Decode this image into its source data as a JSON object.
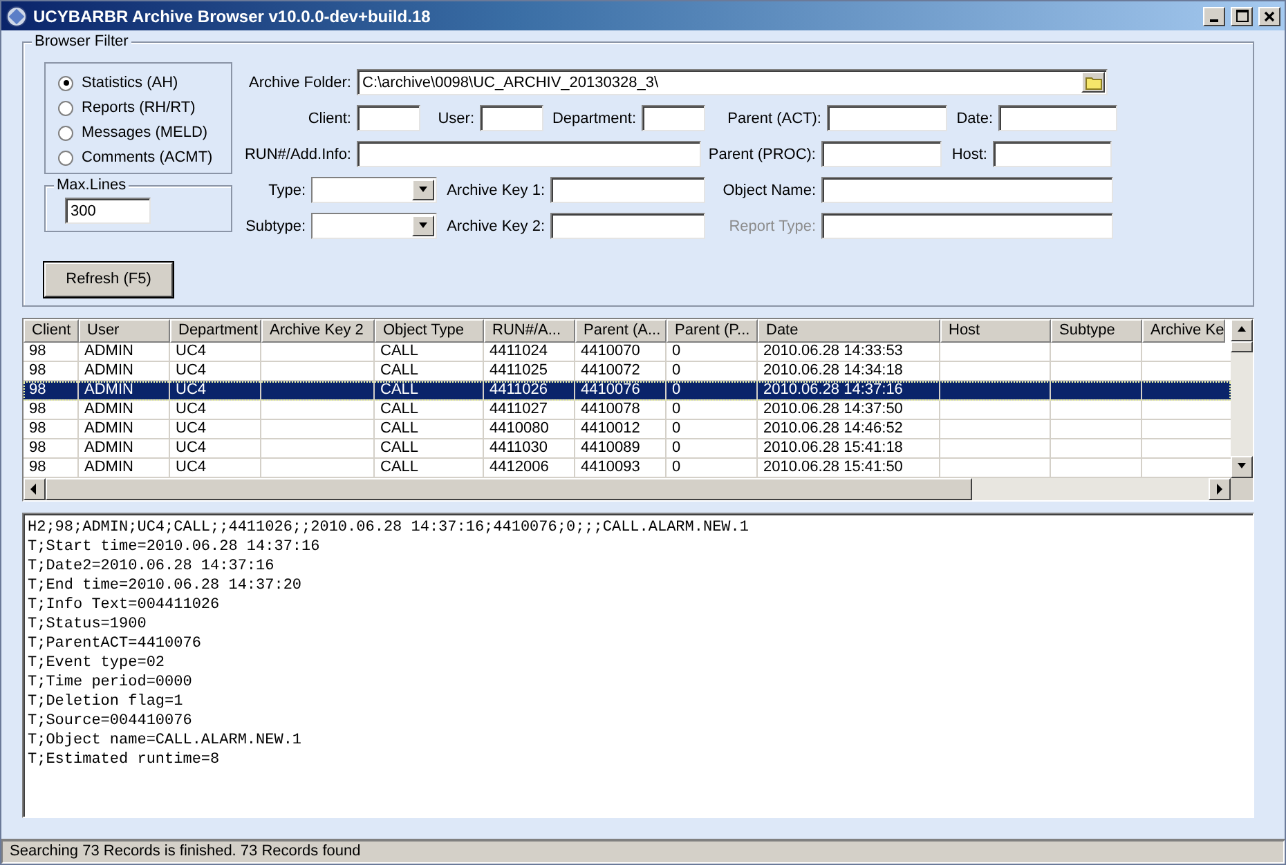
{
  "window": {
    "title": "UCYBARBR Archive Browser v10.0.0-dev+build.18"
  },
  "filter": {
    "title": "Browser Filter",
    "sources": [
      {
        "label": "Statistics (AH)",
        "selected": true
      },
      {
        "label": "Reports (RH/RT)",
        "selected": false
      },
      {
        "label": "Messages (MELD)",
        "selected": false
      },
      {
        "label": "Comments (ACMT)",
        "selected": false
      }
    ],
    "max_lines": {
      "title": "Max.Lines",
      "value": "300"
    },
    "fields": [
      {
        "label": "Archive Folder:",
        "kind": "folder",
        "value": "C:\\archive\\0098\\UC_ARCHIV_20130328_3\\"
      },
      {
        "label": "Client:",
        "kind": "field"
      },
      {
        "label": "User:",
        "kind": "field"
      },
      {
        "label": "Department:",
        "kind": "field"
      },
      {
        "label": "Parent (ACT):",
        "kind": "field"
      },
      {
        "label": "Date:",
        "kind": "field"
      },
      {
        "label": "RUN#/Add.Info:",
        "kind": "field"
      },
      {
        "label": "Parent (PROC):",
        "kind": "field"
      },
      {
        "label": "Host:",
        "kind": "field"
      },
      {
        "label": "Type:",
        "kind": "combo"
      },
      {
        "label": "Archive Key 1:",
        "kind": "field"
      },
      {
        "label": "Object Name:",
        "kind": "field"
      },
      {
        "label": "Subtype:",
        "kind": "combo"
      },
      {
        "label": "Archive Key 2:",
        "kind": "field"
      },
      {
        "label": "Report Type:",
        "kind": "field",
        "disabled": true
      }
    ],
    "refresh_button": "Refresh (F5)"
  },
  "table": {
    "columns": [
      "Client",
      "User",
      "Department",
      "Archive Key 2",
      "Object Type",
      "RUN#/A...",
      "Parent (A...",
      "Parent (P...",
      "Date",
      "Host",
      "Subtype",
      "Archive Ke"
    ],
    "rows": [
      {
        "cells": [
          "98",
          "ADMIN",
          "UC4",
          "",
          "CALL",
          "4411024",
          "4410070",
          "0",
          "2010.06.28 14:33:53",
          "",
          "",
          ""
        ],
        "selected": false
      },
      {
        "cells": [
          "98",
          "ADMIN",
          "UC4",
          "",
          "CALL",
          "4411025",
          "4410072",
          "0",
          "2010.06.28 14:34:18",
          "",
          "",
          ""
        ],
        "selected": false
      },
      {
        "cells": [
          "98",
          "ADMIN",
          "UC4",
          "",
          "CALL",
          "4411026",
          "4410076",
          "0",
          "2010.06.28 14:37:16",
          "",
          "",
          ""
        ],
        "selected": true
      },
      {
        "cells": [
          "98",
          "ADMIN",
          "UC4",
          "",
          "CALL",
          "4411027",
          "4410078",
          "0",
          "2010.06.28 14:37:50",
          "",
          "",
          ""
        ],
        "selected": false
      },
      {
        "cells": [
          "98",
          "ADMIN",
          "UC4",
          "",
          "CALL",
          "4410080",
          "4410012",
          "0",
          "2010.06.28 14:46:52",
          "",
          "",
          ""
        ],
        "selected": false
      },
      {
        "cells": [
          "98",
          "ADMIN",
          "UC4",
          "",
          "CALL",
          "4411030",
          "4410089",
          "0",
          "2010.06.28 15:41:18",
          "",
          "",
          ""
        ],
        "selected": false
      },
      {
        "cells": [
          "98",
          "ADMIN",
          "UC4",
          "",
          "CALL",
          "4412006",
          "4410093",
          "0",
          "2010.06.28 15:41:50",
          "",
          "",
          ""
        ],
        "selected": false
      }
    ]
  },
  "details": [
    "H2;98;ADMIN;UC4;CALL;;4411026;;2010.06.28 14:37:16;4410076;0;;;CALL.ALARM.NEW.1",
    "T;Start time=2010.06.28 14:37:16",
    "T;Date2=2010.06.28 14:37:16",
    "T;End time=2010.06.28 14:37:20",
    "T;Info Text=004411026",
    "T;Status=1900",
    "T;ParentACT=4410076",
    "T;Event type=02",
    "T;Time period=0000",
    "T;Deletion flag=1",
    "T;Source=004410076",
    "T;Object name=CALL.ALARM.NEW.1",
    "T;Estimated runtime=8"
  ],
  "status_bar": "Searching 73 Records is finished. 73 Records found"
}
